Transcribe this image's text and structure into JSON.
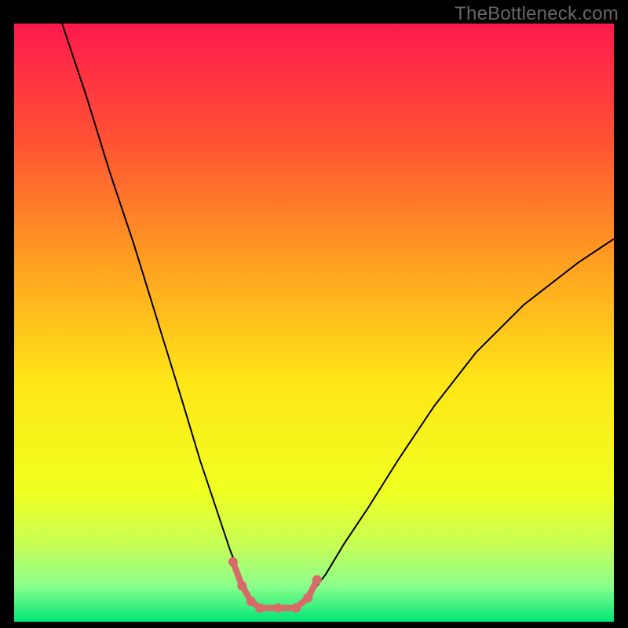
{
  "watermark": "TheBottleneck.com",
  "chart_data": {
    "type": "line",
    "title": "",
    "xlabel": "",
    "ylabel": "",
    "xlim": [
      0,
      100
    ],
    "ylim": [
      0,
      100
    ],
    "grid": false,
    "background_gradient_stops": [
      {
        "offset": 0.0,
        "color": "#ff1a4d"
      },
      {
        "offset": 0.2,
        "color": "#ff5333"
      },
      {
        "offset": 0.4,
        "color": "#ffa021"
      },
      {
        "offset": 0.6,
        "color": "#ffe617"
      },
      {
        "offset": 0.78,
        "color": "#f0ff20"
      },
      {
        "offset": 0.87,
        "color": "#c8ff56"
      },
      {
        "offset": 0.94,
        "color": "#8cff8c"
      },
      {
        "offset": 1.0,
        "color": "#00e676"
      }
    ],
    "series": [
      {
        "name": "bottleneck-curve",
        "stroke": "#000000",
        "stroke_width": 2,
        "x": [
          8,
          12,
          16,
          20,
          24,
          28,
          31,
          34,
          36,
          38,
          39.5,
          41,
          43,
          46,
          49,
          52,
          55,
          59,
          64,
          70,
          77,
          85,
          94,
          100
        ],
        "y": [
          100,
          88,
          75,
          63,
          50,
          37,
          27,
          18,
          12,
          7,
          4,
          2.3,
          2.3,
          2.3,
          4,
          8,
          13,
          19,
          27,
          36,
          45,
          53,
          60,
          64
        ]
      },
      {
        "name": "optimal-zone-markers",
        "stroke": "#d96a6a",
        "stroke_width": 8,
        "marker_radius": 6,
        "x": [
          36.5,
          38,
          39.5,
          41,
          44,
          47,
          49,
          50.5
        ],
        "y": [
          10,
          6,
          3.4,
          2.3,
          2.3,
          2.3,
          4,
          7
        ]
      }
    ]
  }
}
